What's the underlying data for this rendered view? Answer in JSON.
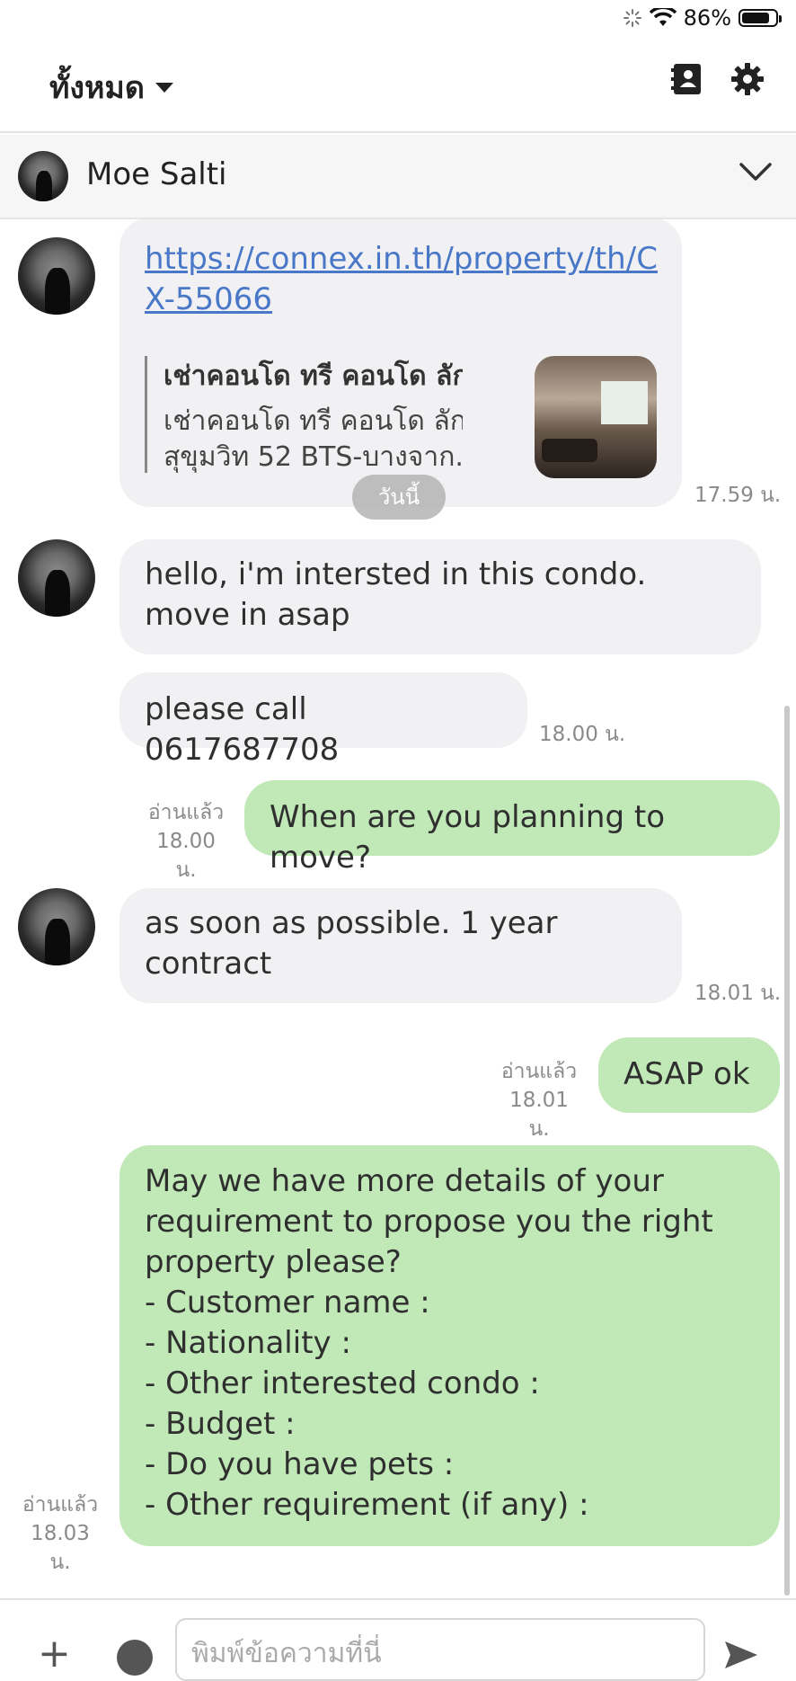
{
  "status_bar": {
    "battery": "86%",
    "battery_level": 0.86
  },
  "header": {
    "filter_label": "ทั้งหมด",
    "icons": [
      "contacts-icon",
      "gear-icon"
    ]
  },
  "contact": {
    "name": "Moe Salti"
  },
  "date_separator": "วันนี้",
  "messages": [
    {
      "direction": "incoming",
      "link": "https://connex.in.th/property/th/CX-55066",
      "link_line1": "https://connex.in.th/property/th/C",
      "link_line2": "X-55066",
      "preview_title": "เช่าคอนโด ทรี คอนโด ลัก...",
      "preview_desc_line1": "เช่าคอนโด ทรี คอนโด ลักซ์",
      "preview_desc_line2": "สุขุมวิท 52 BTS-บางจาก...",
      "time": "17.59 น."
    },
    {
      "direction": "incoming",
      "text": "hello, i'm intersted in this condo. move in asap"
    },
    {
      "direction": "incoming",
      "text": "please call 0617687708",
      "time": "18.00 น."
    },
    {
      "direction": "outgoing",
      "text": "When are you planning to move?",
      "read": "อ่านแล้ว",
      "time": "18.00 น."
    },
    {
      "direction": "incoming",
      "text": "as soon as possible. 1 year contract",
      "time": "18.01 น."
    },
    {
      "direction": "outgoing",
      "text": "ASAP ok",
      "read": "อ่านแล้ว",
      "time": "18.01 น."
    },
    {
      "direction": "outgoing",
      "lines": [
        "May we have more details of your",
        "requirement to propose you the right",
        "property please?",
        "- Customer name :",
        "- Nationality :",
        "- Other interested condo :",
        "- Budget :",
        "- Do you have pets :",
        "- Other requirement (if any) :"
      ],
      "read": "อ่านแล้ว",
      "time": "18.03 น."
    }
  ],
  "input": {
    "placeholder": "พิมพ์ข้อความที่นี่"
  }
}
